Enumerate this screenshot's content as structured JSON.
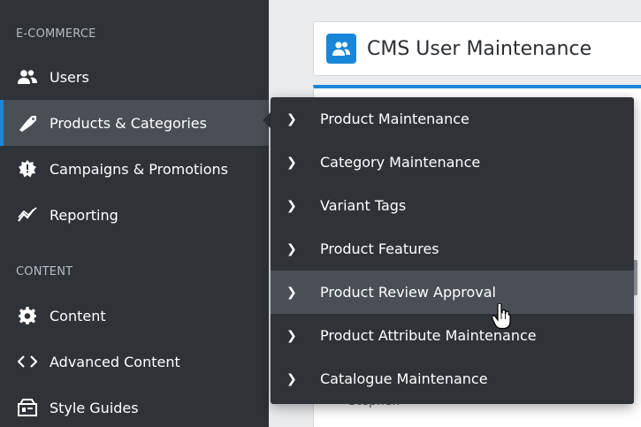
{
  "sidebar": {
    "sections": [
      {
        "label": "E-COMMERCE",
        "items": [
          {
            "label": "Users",
            "icon": "users-icon"
          },
          {
            "label": "Products & Categories",
            "icon": "tag-icon",
            "active": true
          },
          {
            "label": "Campaigns & Promotions",
            "icon": "badge-icon"
          },
          {
            "label": "Reporting",
            "icon": "chart-line-icon"
          }
        ]
      },
      {
        "label": "CONTENT",
        "items": [
          {
            "label": "Content",
            "icon": "gear-icon"
          },
          {
            "label": "Advanced Content",
            "icon": "code-icon"
          },
          {
            "label": "Style Guides",
            "icon": "palette-box-icon"
          }
        ]
      }
    ]
  },
  "main": {
    "title": "CMS User Maintenance",
    "title_icon": "users-icon",
    "peek_text": "Stephen"
  },
  "flyout": {
    "items": [
      {
        "label": "Product Maintenance"
      },
      {
        "label": "Category Maintenance"
      },
      {
        "label": "Variant Tags"
      },
      {
        "label": "Product Features"
      },
      {
        "label": "Product Review Approval",
        "hover": true
      },
      {
        "label": "Product Attribute Maintenance"
      },
      {
        "label": "Catalogue Maintenance"
      }
    ]
  },
  "colors": {
    "sidebar_bg": "#2f3338",
    "active_bg": "#4a4f56",
    "accent": "#1a86d8",
    "text": "#ffffff",
    "section_label": "#b7bcc3"
  }
}
